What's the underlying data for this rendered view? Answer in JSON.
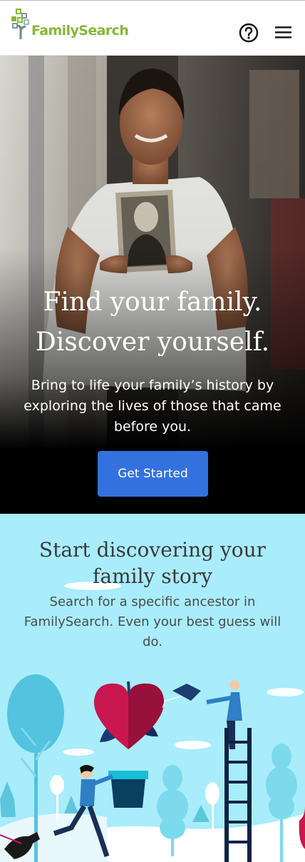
{
  "header": {
    "logo_text": "FamilySearch",
    "help_icon": "help-circle-icon",
    "menu_icon": "hamburger-menu-icon"
  },
  "hero": {
    "title_line1": "Find your family.",
    "title_line2": "Discover yourself.",
    "subtitle": "Bring to life your family’s history by exploring the lives of those that came before you.",
    "cta_label": "Get Started"
  },
  "discover": {
    "title": "Start discovering your family story",
    "subtitle": "Search for a specific ancestor in FamilySearch. Even your best guess will do."
  },
  "colors": {
    "brand_green": "#86b836",
    "cta_blue": "#3372de",
    "discover_bg": "#a9ecfb",
    "heart_red": "#c8174f"
  }
}
